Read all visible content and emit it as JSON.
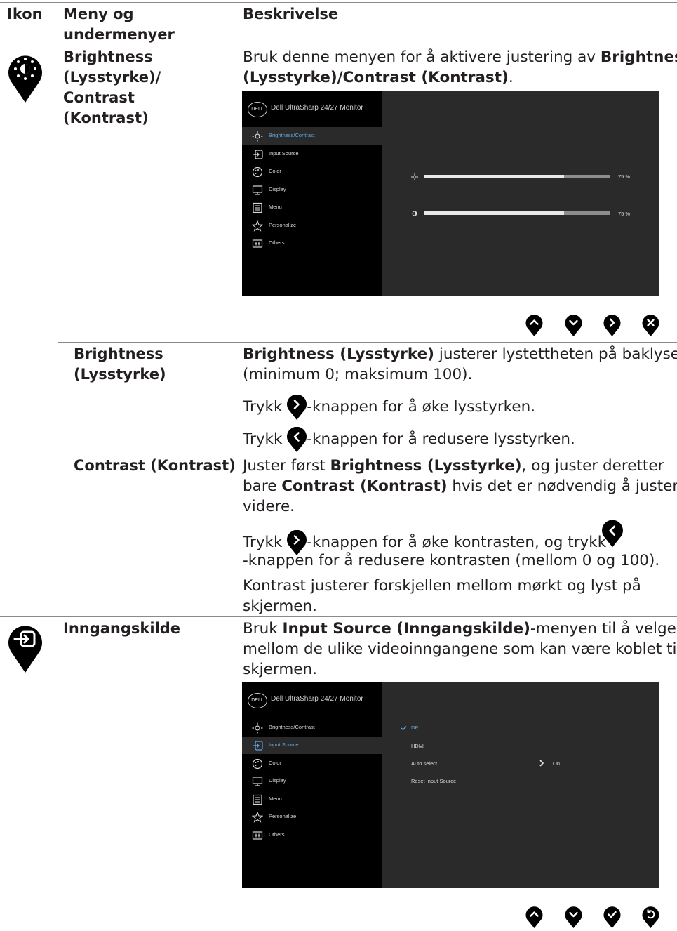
{
  "header": {
    "col1": "Ikon",
    "col2_line1": "Meny og",
    "col2_line2": "undermenyer",
    "col3": "Beskrivelse"
  },
  "brightness_section": {
    "name_lines": [
      "Brightness",
      "(Lysstyrke)/",
      "Contrast",
      "(Kontrast)"
    ],
    "desc": {
      "pre": "Bruk denne menyen for å aktivere justering av ",
      "bold1": "Brightness",
      "bold2": "(Lysstyrke)/Contrast (Kontrast)",
      "post": "."
    }
  },
  "osd1": {
    "brand": "DELL",
    "title": "Dell UltraSharp 24/27 Monitor",
    "menu": [
      "Brightness/Contrast",
      "Input Source",
      "Color",
      "Display",
      "Menu",
      "Personalize",
      "Others"
    ],
    "brightness": {
      "value": 75,
      "label": "75 %"
    },
    "contrast": {
      "value": 75,
      "label": "75 %"
    }
  },
  "brightness_sub": {
    "name_lines": [
      "Brightness",
      "(Lysstyrke)"
    ],
    "desc_bold": "Brightness (Lysstyrke)",
    "desc_rest1": " justerer lystettheten på baklyset",
    "desc_line2": "(minimum 0; maksimum 100).",
    "press_up_pre": "Trykk ",
    "press_up_post": "-knappen for å øke lysstyrken.",
    "press_down_pre": "Trykk ",
    "press_down_post": "-knappen for å redusere lysstyrken."
  },
  "contrast_sub": {
    "name": "Contrast (Kontrast)",
    "l1_pre": "Juster først ",
    "l1_bold": "Brightness (Lysstyrke)",
    "l1_post": ", og juster deretter",
    "l2_pre": "bare ",
    "l2_bold": "Contrast (Kontrast)",
    "l2_post": " hvis det er nødvendig å justere",
    "l3": "videre.",
    "p2_pre": "Trykk ",
    "p2_mid": "-knappen for å øke kontrasten, og trykk",
    "p2_line2": "-knappen for å redusere kontrasten (mellom 0 og 100).",
    "p3_l1": "Kontrast justerer forskjellen mellom mørkt og lyst på",
    "p3_l2": "skjermen."
  },
  "input_section": {
    "name": "Inngangskilde",
    "l1_pre": "Bruk ",
    "l1_bold": "Input Source (Inngangskilde)",
    "l1_post": "-menyen til å velge",
    "l2": "mellom de ulike videoinngangene som kan være koblet til",
    "l3": "skjermen."
  },
  "osd2": {
    "brand": "DELL",
    "title": "Dell UltraSharp 24/27 Monitor",
    "menu": [
      "Brightness/Contrast",
      "Input Source",
      "Color",
      "Display",
      "Menu",
      "Personalize",
      "Others"
    ],
    "options": [
      "DP",
      "HDMI",
      "Auto select",
      "Reset Input Source"
    ],
    "auto_value": "On"
  },
  "colors": {
    "accent_blue": "#5ea7e0",
    "osd_side": "#000000",
    "osd_panel": "#2a2a2a",
    "text": "#231f20"
  }
}
